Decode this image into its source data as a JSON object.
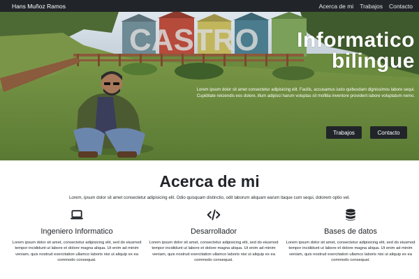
{
  "navbar": {
    "brand": "Hans Muñoz Ramos",
    "links": [
      "Acerca de mi",
      "Trabajos",
      "Contacto"
    ]
  },
  "hero": {
    "sign_text": "CASTRO",
    "title_line1": "Informatico",
    "title_line2": "bilingue",
    "text": "Lorem ipsum dolor sit amet consectetur adipisicing elit. Facilis, accusamus iusto quibusdam dignissimos labore sequi. Cupiditate reiciendis eos dolore, illum adipisci harum voluptas sit mollitia inventore provident labore voluptatum nemo.",
    "buttons": [
      "Trabajos",
      "Contacto"
    ]
  },
  "about": {
    "title": "Acerca de mi",
    "lead": "Lorem, ipsum dolor sit amet consectetur adipisicing elit. Odio quisquam distinctio, odit laborum aliquam earum itaque cum sequi, dolorem optio vel.",
    "columns": [
      {
        "icon": "laptop-icon",
        "title": "Ingeniero Informatico",
        "text": "Lorem ipsum dolor sit amet, consectetur adipisicing elit, sed do eiusmod tempor incididunt ut labore et dolore magna aliqua. Ut enim ad minim veniam, quis nostrud exercitation ullamco laboris nisi ut aliquip ex ea commodo consequat."
      },
      {
        "icon": "code-icon",
        "title": "Desarrollador",
        "text": "Lorem ipsum dolor sit amet, consectetur adipisicing elit, sed do eiusmod tempor incididunt ut labore et dolore magna aliqua. Ut enim ad minim veniam, quis nostrud exercitation ullamco laboris nisi ut aliquip ex ea commodo consequat."
      },
      {
        "icon": "database-icon",
        "title": "Bases de datos",
        "text": "Lorem ipsum dolor sit amet, consectetur adipisicing elit, sed do eiusmod tempor incididunt ut labore et dolore magna aliqua. Ut enim ad minim veniam, quis nostrud exercitation ullamco laboris nisi ut aliquip ex ea commodo consequat."
      }
    ]
  },
  "colors": {
    "navbar": "#212529",
    "button": "#212529",
    "grass": "#6a8a3e",
    "sky": "#cfd9e3"
  }
}
